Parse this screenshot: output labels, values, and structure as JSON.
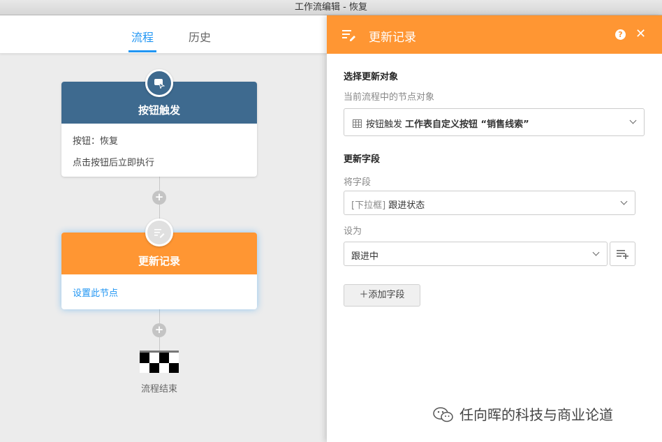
{
  "window": {
    "title": "工作流编辑 - 恢复"
  },
  "tabs": [
    {
      "label": "流程",
      "active": true
    },
    {
      "label": "历史",
      "active": false
    }
  ],
  "flow": {
    "trigger_node": {
      "title": "按钮触发",
      "icon": "button-cursor-icon",
      "button_line": "按钮：恢复",
      "desc": "点击按钮后立即执行"
    },
    "update_node": {
      "title": "更新记录",
      "icon": "edit-list-icon",
      "setup_link": "设置此节点"
    },
    "add_icon": "+",
    "end_label": "流程结束"
  },
  "panel": {
    "title": "更新记录",
    "header_color": "#ff9633",
    "help_icon": "?",
    "close_icon": "✕",
    "target_section": {
      "title": "选择更新对象",
      "subtitle": "当前流程中的节点对象",
      "select_prefix": "按钮触发",
      "select_value": "工作表自定义按钮 “销售线索”"
    },
    "fields_section": {
      "title": "更新字段",
      "field_label": "将字段",
      "field_tag": "[下拉框]",
      "field_value": "跟进状态",
      "set_label": "设为",
      "set_value": "跟进中",
      "add_button": "＋添加字段"
    }
  },
  "watermark": "任向晖的科技与商业论道",
  "colors": {
    "accent_blue": "#2196f3",
    "trigger_header": "#3e6a8f",
    "update_header": "#ff9633"
  }
}
